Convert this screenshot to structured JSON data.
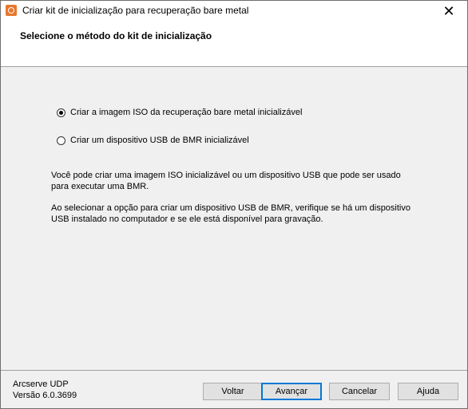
{
  "window": {
    "title": "Criar kit de inicialização para recuperação bare metal",
    "close_label": "✕"
  },
  "header": {
    "title": "Selecione o método do kit de inicialização"
  },
  "options": [
    {
      "label": "Criar a imagem ISO da recuperação bare metal inicializável",
      "checked": true
    },
    {
      "label": "Criar um dispositivo USB de BMR inicializável",
      "checked": false
    }
  ],
  "description": {
    "line1": "Você pode criar uma imagem ISO inicializável ou um dispositivo USB que pode ser usado",
    "line2": "para executar uma BMR.",
    "line3": "Ao selecionar a opção para criar um dispositivo USB de BMR, verifique se há um dispositivo",
    "line4": "USB instalado no computador e se ele está disponível para gravação."
  },
  "footer": {
    "product_name": "Arcserve UDP",
    "version": "Versão 6.0.3699",
    "buttons": {
      "back": "Voltar",
      "next": "Avançar",
      "cancel": "Cancelar",
      "help": "Ajuda"
    }
  }
}
